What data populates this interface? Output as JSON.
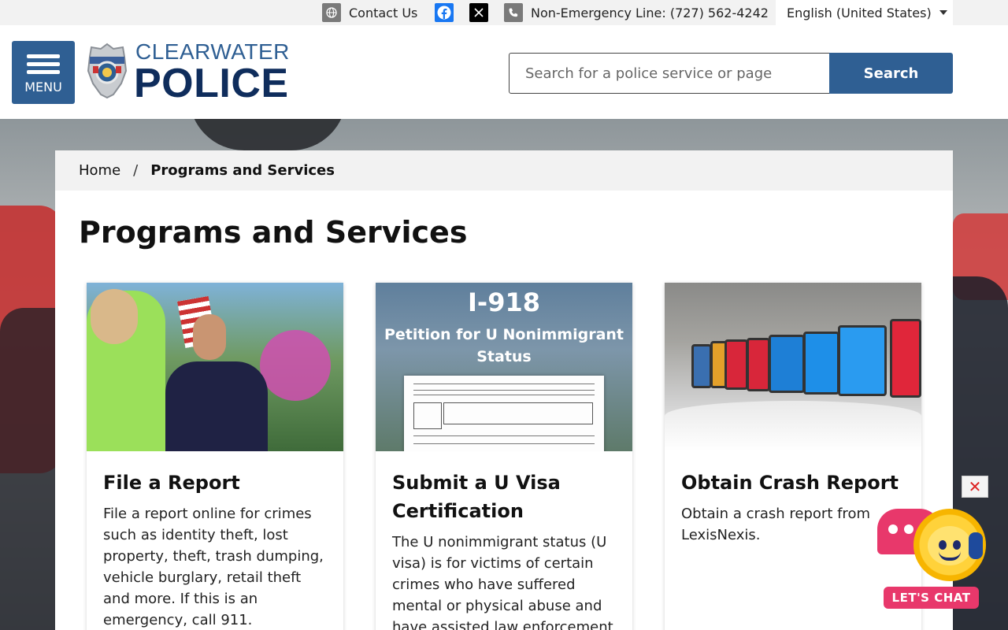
{
  "topbar": {
    "contact_label": "Contact Us",
    "non_emergency_label": "Non-Emergency Line: (727) 562-4242",
    "language_selected": "English (United States)"
  },
  "header": {
    "menu_label": "MENU",
    "logo_top": "CLEARWATER",
    "logo_bottom": "POLICE",
    "search_placeholder": "Search for a police service or page",
    "search_button": "Search"
  },
  "breadcrumb": {
    "home": "Home",
    "separator": "/",
    "current": "Programs and Services"
  },
  "page": {
    "title": "Programs and Services"
  },
  "cards": [
    {
      "title": "File a Report",
      "description": "File a report online for crimes such as identity theft, lost property, theft, trash dumping, vehicle burglary, retail theft and more. If this is an emergency, call 911."
    },
    {
      "title": "Submit a U Visa Certification",
      "description": "The U nonimmigrant status (U visa) is for victims of certain crimes who have suffered mental or physical abuse and have assisted law enforcement",
      "image_heading": "I-918",
      "image_subheading": "Petition for U Nonimmigrant Status"
    },
    {
      "title": "Obtain Crash Report",
      "description": "Obtain a crash report from LexisNexis."
    }
  ],
  "chat": {
    "close_symbol": "✕",
    "label": "LET'S CHAT"
  },
  "colors": {
    "brand_blue": "#2f5f93",
    "brand_navy": "#0f2d5c",
    "chat_pink": "#e8386b",
    "facebook_blue": "#1877f2"
  },
  "icons": [
    "globe-icon",
    "facebook-icon",
    "x-icon",
    "phone-icon",
    "hamburger-icon",
    "police-badge-icon",
    "caret-down-icon",
    "chat-bubble-icon",
    "sun-mascot-icon",
    "close-icon"
  ]
}
